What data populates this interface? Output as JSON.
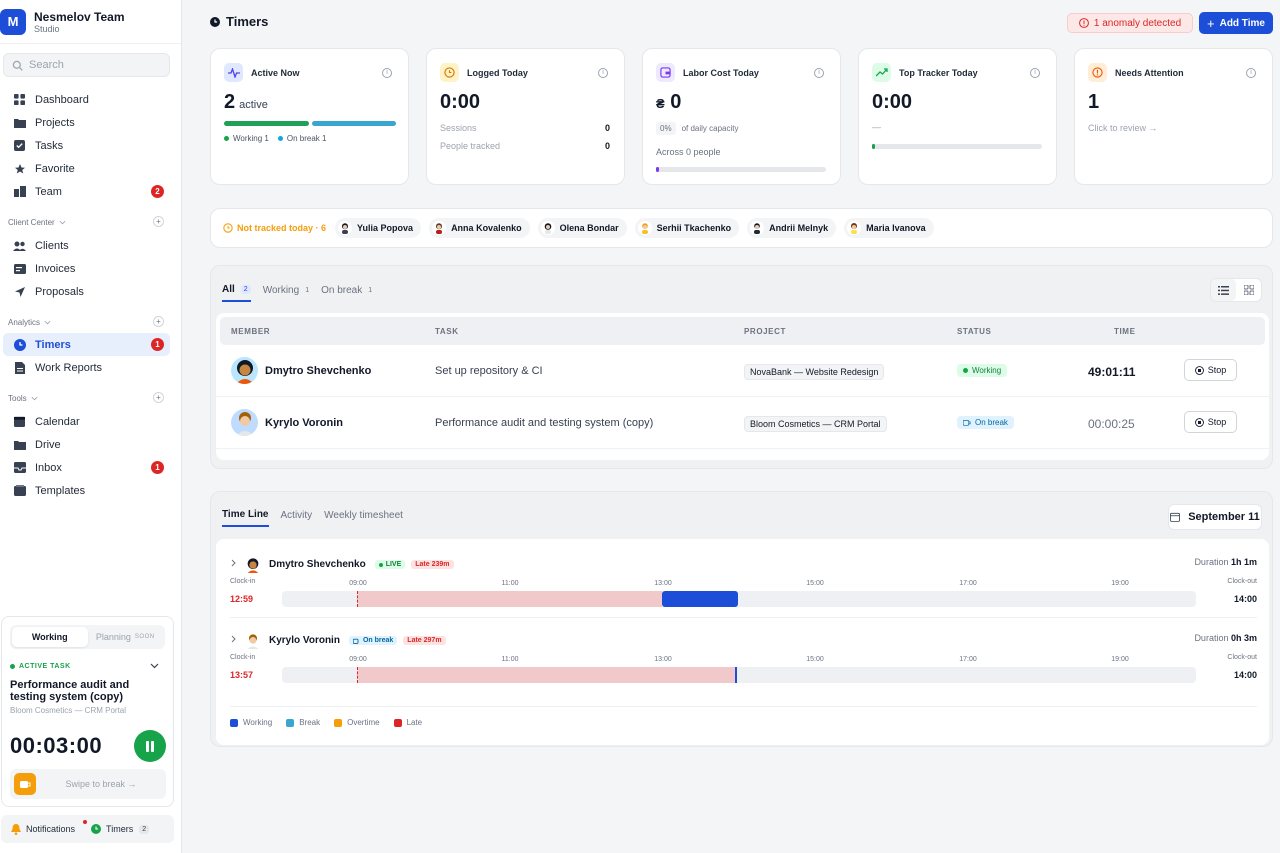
{
  "brand": {
    "initial": "M",
    "name": "Nesmelov Team",
    "sub": "Studio"
  },
  "search": {
    "placeholder": "Search"
  },
  "nav": {
    "main": [
      {
        "label": "Dashboard"
      },
      {
        "label": "Projects"
      },
      {
        "label": "Tasks"
      },
      {
        "label": "Favorite"
      },
      {
        "label": "Team",
        "badge": "2"
      }
    ],
    "client_center": {
      "title": "Client Center",
      "items": [
        {
          "label": "Clients"
        },
        {
          "label": "Invoices"
        },
        {
          "label": "Proposals"
        }
      ]
    },
    "analytics": {
      "title": "Analytics",
      "items": [
        {
          "label": "Timers",
          "badge": "1"
        },
        {
          "label": "Work Reports"
        }
      ]
    },
    "tools": {
      "title": "Tools",
      "items": [
        {
          "label": "Calendar"
        },
        {
          "label": "Drive"
        },
        {
          "label": "Inbox",
          "badge": "1"
        },
        {
          "label": "Templates"
        }
      ]
    }
  },
  "active_panel": {
    "seg_working": "Working",
    "seg_planning": "Planning",
    "seg_soon": "SOON",
    "header": "ACTIVE TASK",
    "task_title": "Performance audit and testing system (copy)",
    "task_project": "Bloom Cosmetics — CRM Portal",
    "timer": "00:03:00",
    "swipe_label": "Swipe to break →"
  },
  "bottom_bar": {
    "notifications": "Notifications",
    "timers": "Timers",
    "timers_count": "2"
  },
  "header": {
    "title": "Timers",
    "anomaly": "1 anomaly detected",
    "add_time": "Add Time"
  },
  "cards": {
    "active_now": {
      "label": "Active Now",
      "value": "2",
      "unit": "active",
      "working": "Working 1",
      "on_break": "On break 1",
      "working_share": 0.5
    },
    "logged_today": {
      "label": "Logged Today",
      "value": "0:00",
      "sessions_label": "Sessions",
      "sessions": "0",
      "people_label": "People tracked",
      "people": "0"
    },
    "labor_cost": {
      "label": "Labor Cost Today",
      "currency": "₴",
      "value": "0",
      "pct": "0%",
      "pct_label": "of daily capacity",
      "across": "Across 0 people"
    },
    "top_tracker": {
      "label": "Top Tracker Today",
      "value": "0:00",
      "who": "—"
    },
    "needs_attention": {
      "label": "Needs Attention",
      "value": "1",
      "cta": "Click to review →"
    }
  },
  "not_tracked": {
    "label": "Not tracked today · 6",
    "people": [
      "Yulia Popova",
      "Anna Kovalenko",
      "Olena Bondar",
      "Serhii Tkachenko",
      "Andrii Melnyk",
      "Maria Ivanova"
    ]
  },
  "table": {
    "tabs": [
      {
        "label": "All",
        "count": "2"
      },
      {
        "label": "Working",
        "count": "1"
      },
      {
        "label": "On break",
        "count": "1"
      }
    ],
    "columns": {
      "member": "MEMBER",
      "task": "TASK",
      "project": "PROJECT",
      "status": "STATUS",
      "time": "TIME"
    },
    "rows": [
      {
        "member": "Dmytro Shevchenko",
        "task": "Set up repository & CI",
        "project": "NovaBank — Website Redesign",
        "status": "Working",
        "time": "49:01:11",
        "action": "Stop"
      },
      {
        "member": "Kyrylo Voronin",
        "task": "Performance audit and testing system (copy)",
        "project": "Bloom Cosmetics — CRM Portal",
        "status": "On break",
        "time": "00:00:25",
        "action": "Stop"
      }
    ]
  },
  "timeline": {
    "tabs": [
      "Time Line",
      "Activity",
      "Weekly timesheet"
    ],
    "date": "September 11",
    "ticks": [
      "09:00",
      "11:00",
      "13:00",
      "15:00",
      "17:00",
      "19:00"
    ],
    "clock_in_label": "Clock-in",
    "clock_out_label": "Clock-out",
    "duration_label": "Duration",
    "rows": [
      {
        "name": "Dmytro Shevchenko",
        "tag1": "LIVE",
        "tag2": "Late 239m",
        "duration": "1h 1m",
        "clock_in": "12:59",
        "clock_out": "14:00"
      },
      {
        "name": "Kyrylo Voronin",
        "tag1": "On break",
        "tag2": "Late 297m",
        "duration": "0h 3m",
        "clock_in": "13:57",
        "clock_out": "14:00"
      }
    ],
    "legend": [
      "Working",
      "Break",
      "Overtime",
      "Late"
    ]
  },
  "colors": {
    "accent": "#1d4ed8",
    "working": "#16a34a",
    "break": "#0ea5e9",
    "overtime": "#f59e0b",
    "late": "#dc2626"
  }
}
